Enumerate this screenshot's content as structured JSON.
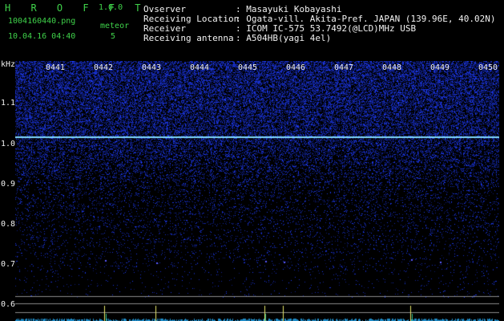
{
  "app": {
    "logo": "H R O F F T",
    "version": "1.0.0",
    "filename": "1004160440.png",
    "datetime": "10.04.16 04:40",
    "counter_label": "meteor",
    "counter_value": "5"
  },
  "station": {
    "labels": [
      "Ovserver",
      "Receiving Location",
      "Receiver",
      "Receiving antenna"
    ],
    "values": [
      ": Masayuki Kobayashi",
      ": Ogata-vill. Akita-Pref. JAPAN (139.96E, 40.02N)",
      ": ICOM IC-575 53.7492(@LCD)MHz USB",
      ": A504HB(yagi 4el)"
    ]
  },
  "axis": {
    "unit": "kHz",
    "freq_labels": [
      "1.1",
      "1.0",
      "0.9",
      "0.8",
      "0.7",
      "0.6"
    ],
    "time_labels": [
      "0441",
      "0442",
      "0443",
      "0444",
      "0445",
      "0446",
      "0447",
      "0448",
      "0449",
      "0450"
    ]
  },
  "colors": {
    "noise_bright": "#3c5cff",
    "noise_dim": "#1a2a9a",
    "carrier": "#7fd8ff",
    "text_green": "#3fd24a",
    "text_white": "#f2f2f2",
    "grid": "#8a8a8a"
  }
}
